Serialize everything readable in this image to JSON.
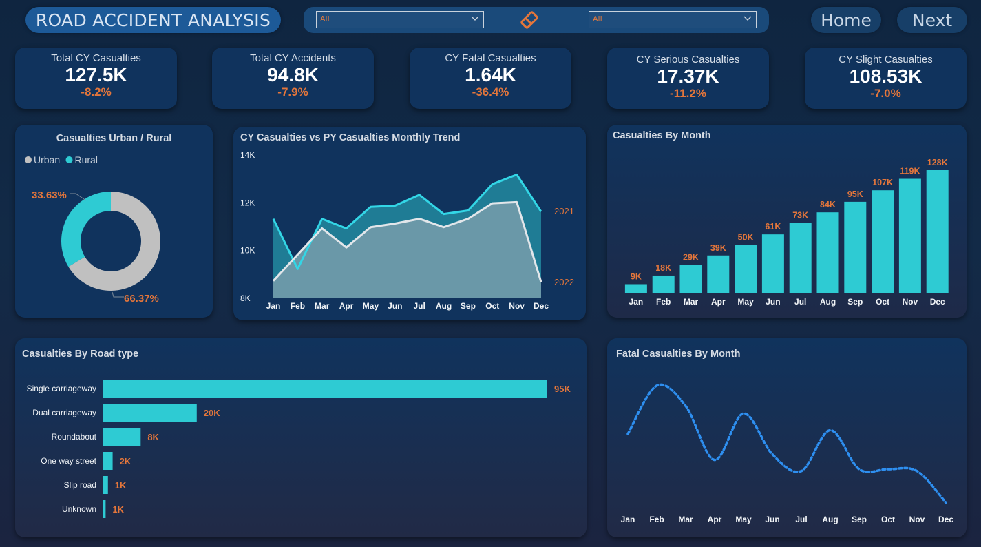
{
  "header": {
    "title": "ROAD ACCIDENT ANALYSIS",
    "filter1_value": "All",
    "filter2_value": "All",
    "home_label": "Home",
    "next_label": "Next"
  },
  "kpis": [
    {
      "label": "Total CY Casualties",
      "value": "127.5K",
      "change": "-8.2%"
    },
    {
      "label": "Total CY Accidents",
      "value": "94.8K",
      "change": "-7.9%"
    },
    {
      "label": "CY Fatal Casualties",
      "value": "1.64K",
      "change": "-36.4%"
    },
    {
      "label": "CY Serious Casualties",
      "value": "17.37K",
      "change": "-11.2%"
    },
    {
      "label": "CY Slight Casualties",
      "value": "108.53K",
      "change": "-7.0%"
    }
  ],
  "colors": {
    "accent": "#2ecbd3",
    "orange": "#e4763b",
    "grey": "#c0c0c0",
    "card": "#10335d",
    "dotted_line": "#2e8ff0"
  },
  "chart_data": [
    {
      "type": "pie",
      "title": "Casualties Urban / Rural",
      "legend_position": "top-left",
      "categories": [
        "Urban",
        "Rural"
      ],
      "values": [
        66.37,
        33.63
      ],
      "labels": [
        "66.37%",
        "33.63%"
      ],
      "colors": [
        "#c0c0c0",
        "#2ecbd3"
      ]
    },
    {
      "type": "area",
      "title": "CY Casualties vs PY Casualties Monthly Trend",
      "categories": [
        "Jan",
        "Feb",
        "Mar",
        "Apr",
        "May",
        "Jun",
        "Jul",
        "Aug",
        "Sep",
        "Oct",
        "Nov",
        "Dec"
      ],
      "yticks": [
        "14K",
        "12K",
        "10K",
        "8K"
      ],
      "ylim": [
        8000,
        14000
      ],
      "series": [
        {
          "name": "2021",
          "values": [
            11300,
            9200,
            11300,
            10900,
            11800,
            11850,
            12300,
            11500,
            11650,
            12750,
            13150,
            11600
          ]
        },
        {
          "name": "2022",
          "values": [
            8700,
            9800,
            10900,
            10100,
            10950,
            11100,
            11300,
            10950,
            11300,
            11950,
            12000,
            8650
          ]
        }
      ]
    },
    {
      "type": "bar",
      "title": "Casualties By Month",
      "categories": [
        "Jan",
        "Feb",
        "Mar",
        "Apr",
        "May",
        "Jun",
        "Jul",
        "Aug",
        "Sep",
        "Oct",
        "Nov",
        "Dec"
      ],
      "values": [
        9,
        18,
        29,
        39,
        50,
        61,
        73,
        84,
        95,
        107,
        119,
        128
      ],
      "labels": [
        "9K",
        "18K",
        "29K",
        "39K",
        "50K",
        "61K",
        "73K",
        "84K",
        "95K",
        "107K",
        "119K",
        "128K"
      ],
      "ylim": [
        0,
        128
      ]
    },
    {
      "type": "bar",
      "orientation": "horizontal",
      "title": "Casualties By Road type",
      "categories": [
        "Single carriageway",
        "Dual carriageway",
        "Roundabout",
        "One way street",
        "Slip road",
        "Unknown"
      ],
      "values": [
        95,
        20,
        8,
        2,
        1,
        0.5
      ],
      "labels": [
        "95K",
        "20K",
        "8K",
        "2K",
        "1K",
        "1K"
      ],
      "xlim": [
        0,
        95
      ]
    },
    {
      "type": "line",
      "title": "Fatal Casualties By Month",
      "categories": [
        "Jan",
        "Feb",
        "Mar",
        "Apr",
        "May",
        "Jun",
        "Jul",
        "Aug",
        "Sep",
        "Oct",
        "Nov",
        "Dec"
      ],
      "values": [
        157,
        183,
        172,
        143,
        168,
        146,
        137,
        159,
        138,
        138,
        137,
        120
      ],
      "ylim": [
        115,
        190
      ]
    }
  ]
}
